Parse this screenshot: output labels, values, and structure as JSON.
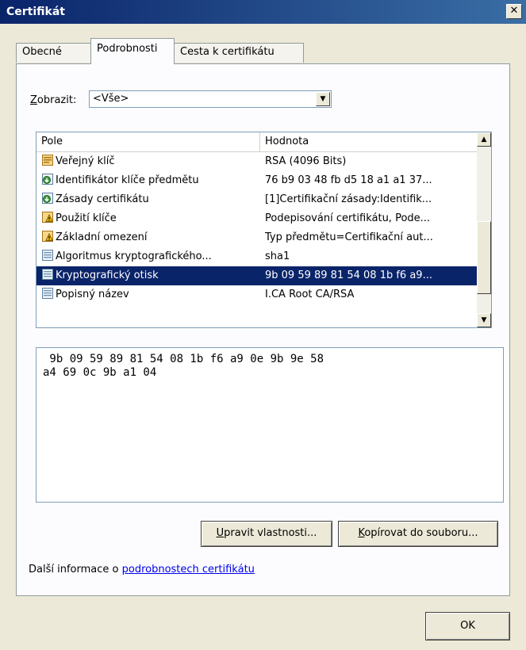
{
  "window": {
    "title": "Certifikát",
    "close_label": "✕"
  },
  "tabs": [
    {
      "label": "Obecné"
    },
    {
      "label": "Podrobnosti"
    },
    {
      "label": "Cesta k certifikátu"
    }
  ],
  "show": {
    "label_accel": "Z",
    "label_rest": "obrazit:",
    "value": "<Vše>"
  },
  "list": {
    "columns": [
      "Pole",
      "Hodnota"
    ],
    "rows": [
      {
        "field": "Veřejný klíč",
        "value": "RSA (4096 Bits)",
        "icon": "certificate-field-icon"
      },
      {
        "field": "Identifikátor klíče předmětu",
        "value": "76 b9 03 48 fb d5 18 a1 a1 37...",
        "icon": "extension-icon"
      },
      {
        "field": "Zásady certifikátu",
        "value": "[1]Certifikační zásady:Identifik...",
        "icon": "extension-icon"
      },
      {
        "field": "Použití klíče",
        "value": "Podepisování certifikátu, Pode...",
        "icon": "critical-extension-icon"
      },
      {
        "field": "Základní omezení",
        "value": "Typ předmětu=Certifikační aut...",
        "icon": "critical-extension-icon"
      },
      {
        "field": "Algoritmus kryptografického...",
        "value": "sha1",
        "icon": "property-icon"
      },
      {
        "field": "Kryptografický otisk",
        "value": "9b 09 59 89 81 54 08 1b f6 a9...",
        "icon": "property-icon"
      },
      {
        "field": "Popisný název",
        "value": "I.CA Root CA/RSA",
        "icon": "property-icon"
      }
    ]
  },
  "detail": {
    "lines": [
      " 9b 09 59 89 81 54 08 1b f6 a9 0e 9b 9e 58",
      "a4 69 0c 9b a1 04"
    ]
  },
  "buttons": {
    "edit_accel": "U",
    "edit_rest": "pravit vlastnosti...",
    "copy_accel": "K",
    "copy_rest": "opírovat do souboru...",
    "ok": "OK"
  },
  "more_info": {
    "prefix": "Další informace o ",
    "link": "podrobnostech certifikátu"
  },
  "colors": {
    "selection": "#0a246a",
    "titlebar": "#0a246a",
    "link": "#0000ee"
  }
}
